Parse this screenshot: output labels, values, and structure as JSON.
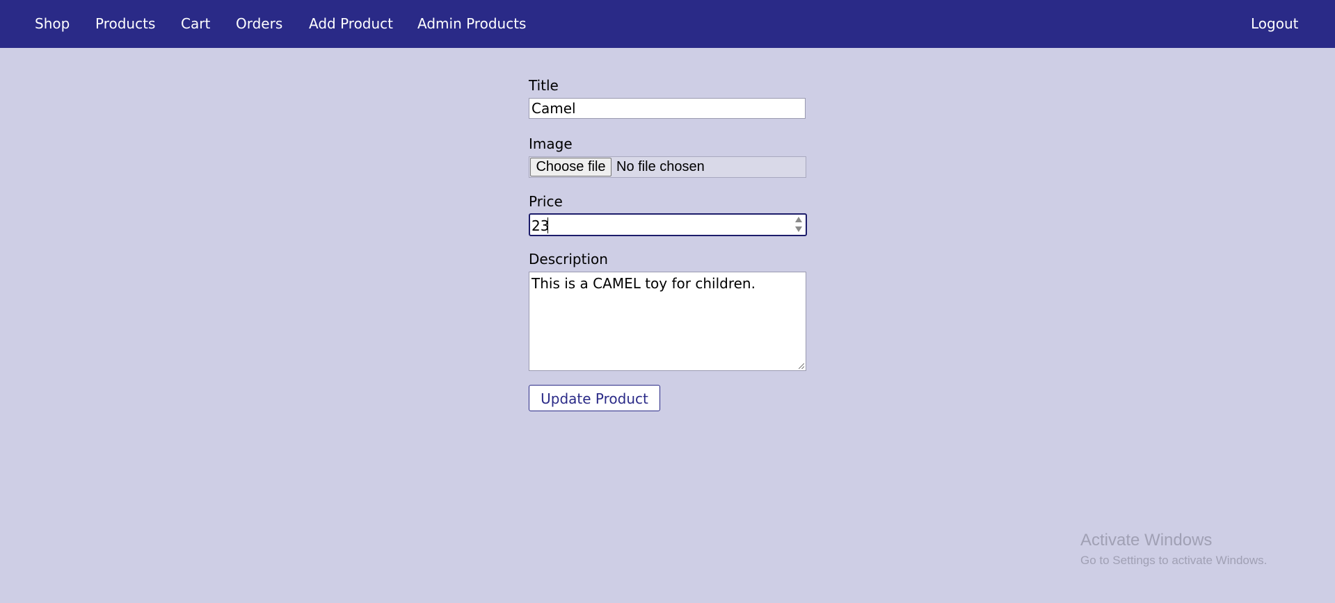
{
  "nav": {
    "items": [
      {
        "label": "Shop"
      },
      {
        "label": "Products"
      },
      {
        "label": "Cart"
      },
      {
        "label": "Orders"
      },
      {
        "label": "Add Product"
      },
      {
        "label": "Admin Products"
      }
    ],
    "logout_label": "Logout"
  },
  "form": {
    "title_label": "Title",
    "title_value": "Camel",
    "image_label": "Image",
    "file_button_label": "Choose file",
    "file_status": "No file chosen",
    "price_label": "Price",
    "price_value": "23",
    "description_label": "Description",
    "description_value": "This is a CAMEL toy for children.",
    "submit_label": "Update Product"
  },
  "watermark": {
    "title": "Activate Windows",
    "subtitle": "Go to Settings to activate Windows."
  },
  "colors": {
    "header_bg": "#2a2a87",
    "page_bg": "#cecee5",
    "accent": "#2a2a87"
  }
}
